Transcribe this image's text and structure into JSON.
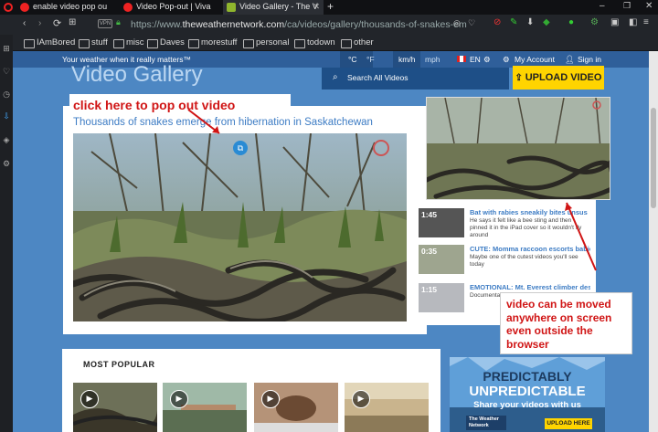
{
  "tabs": [
    {
      "title": "enable video pop ou",
      "color": "#e22"
    },
    {
      "title": "Video Pop-out | Viva",
      "color": "#e22"
    },
    {
      "title": "Video Gallery - The V",
      "color": "#8fb52d"
    }
  ],
  "address": {
    "url_prefix": "https://www.",
    "url_domain": "theweathernetwork.com",
    "url_path": "/ca/videos/gallery/thousands-of-snakes-em",
    "vpn": "VPN"
  },
  "bookmarks": [
    "IAmBored",
    "stuff",
    "misc",
    "Daves",
    "morestuff",
    "personal",
    "todown",
    "other"
  ],
  "site": {
    "tagline": "Your weather when it really matters™",
    "unit_c": "°C",
    "unit_f": "°F",
    "unit_kmh": "km/h",
    "unit_mph": "mph",
    "lang": "EN",
    "my_account": "My Account",
    "sign_in": "Sign in",
    "search_placeholder": "Search All Videos",
    "upload_button": "UPLOAD VIDEO",
    "gallery_title": "Video Gallery"
  },
  "main_video": {
    "title": "Thousands of snakes emerge from hibernation in Saskatchewan"
  },
  "annotations": {
    "click_here": "click here to pop out video",
    "move_line1": "video can be moved",
    "move_line2": "anywhere on screen",
    "move_line3": "even outside the",
    "move_line4": "browser"
  },
  "related": [
    {
      "duration": "1:45",
      "title": "Bat with rabies sneakily bites unsus",
      "desc": "He says it felt like a bee sting and then pinned it in the iPad cover so it wouldn't fly around"
    },
    {
      "duration": "0:35",
      "title": "CUTE: Momma raccoon escorts babie...",
      "desc": "Maybe one of the cutest videos you'll see today"
    },
    {
      "duration": "1:15",
      "title": "EMOTIONAL: Mt. Everest climber des...",
      "desc": "Documentar the realistic when trying"
    }
  ],
  "popular": {
    "title": "MOST POPULAR"
  },
  "ad": {
    "line1": "PREDICTABLY",
    "line2": "UNPREDICTABLE",
    "line3": "Share your videos with us",
    "logo": "The Weather Network",
    "upload": "UPLOAD HERE"
  }
}
